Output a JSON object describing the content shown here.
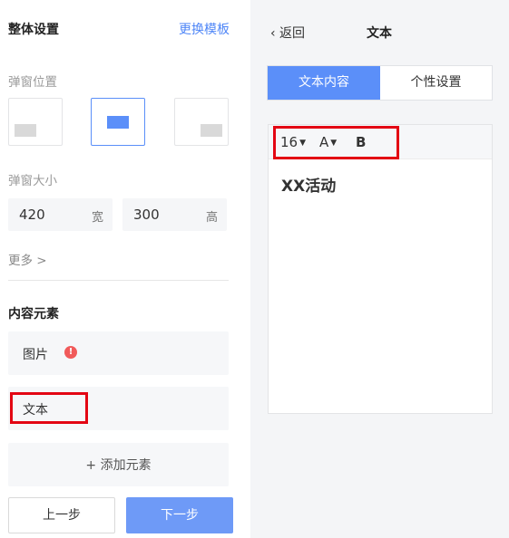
{
  "left": {
    "title": "整体设置",
    "switch_template": "更换模板",
    "position_label": "弹窗位置",
    "size_label": "弹窗大小",
    "width_value": "420",
    "width_unit": "宽",
    "height_value": "300",
    "height_unit": "高",
    "more": "更多 >",
    "content_title": "内容元素",
    "elements": [
      {
        "label": "图片",
        "warning": "!"
      },
      {
        "label": "文本"
      }
    ],
    "add_element": "+ 添加元素",
    "prev_button": "上一步",
    "next_button": "下一步"
  },
  "right": {
    "back": "‹  返回",
    "title": "文本",
    "tabs": [
      "文本内容",
      "个性设置"
    ],
    "toolbar": {
      "font_size": "16",
      "font_color": "A",
      "bold": "B"
    },
    "editor_text": "XX活动"
  },
  "colors": {
    "accent": "#5b8ff9",
    "highlight": "#e30613",
    "warning": "#f15a5a"
  }
}
